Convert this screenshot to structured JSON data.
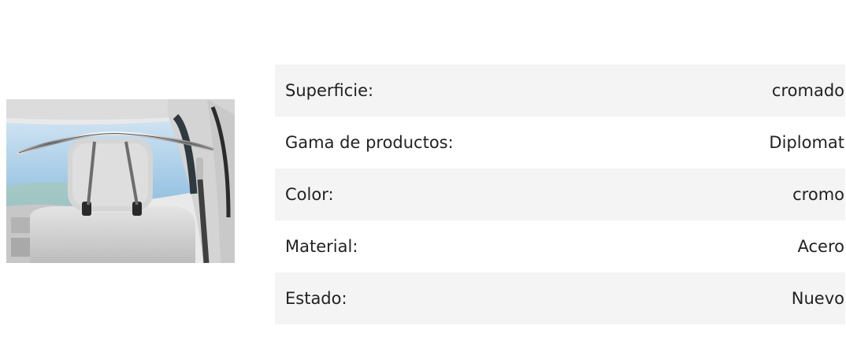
{
  "product": {
    "image_icon": "car-seat-coat-hanger-image"
  },
  "specs": [
    {
      "label": "Superficie:",
      "value": "cromado"
    },
    {
      "label": "Gama de productos:",
      "value": "Diplomat"
    },
    {
      "label": "Color:",
      "value": "cromo"
    },
    {
      "label": "Material:",
      "value": "Acero"
    },
    {
      "label": "Estado:",
      "value": "Nuevo"
    }
  ]
}
